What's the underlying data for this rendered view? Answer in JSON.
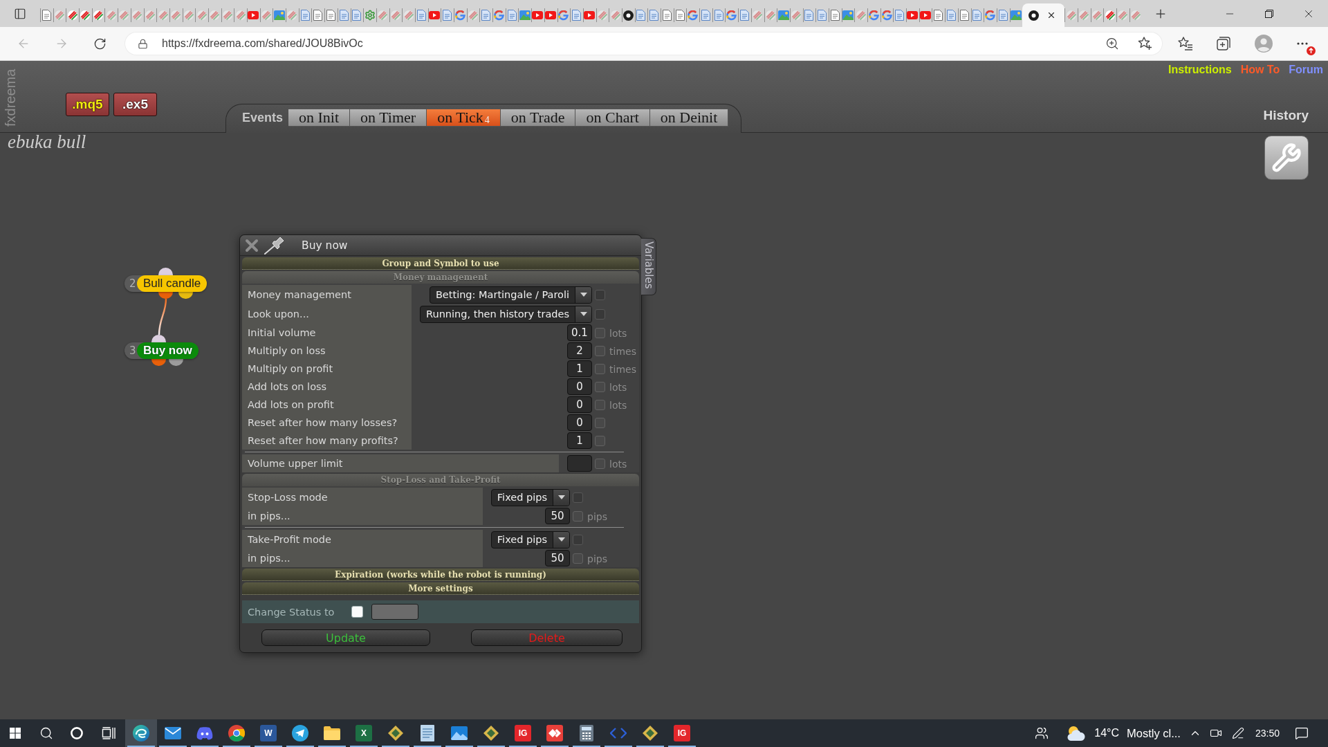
{
  "browser": {
    "tabs": [
      {
        "kind": "page",
        "sleeping": false,
        "selected": false
      },
      {
        "kind": "pen",
        "sleeping": true,
        "selected": false
      },
      {
        "kind": "pen",
        "sleeping": false,
        "selected": false
      },
      {
        "kind": "pen",
        "sleeping": false,
        "selected": false
      },
      {
        "kind": "pen",
        "sleeping": false,
        "selected": false
      },
      {
        "kind": "pen",
        "sleeping": true,
        "selected": false
      },
      {
        "kind": "pen",
        "sleeping": true,
        "selected": false
      },
      {
        "kind": "pen",
        "sleeping": true,
        "selected": false
      },
      {
        "kind": "pen",
        "sleeping": true,
        "selected": false
      },
      {
        "kind": "pen",
        "sleeping": true,
        "selected": false
      },
      {
        "kind": "pen",
        "sleeping": true,
        "selected": false
      },
      {
        "kind": "pen",
        "sleeping": true,
        "selected": false
      },
      {
        "kind": "pen",
        "sleeping": true,
        "selected": false
      },
      {
        "kind": "pen",
        "sleeping": true,
        "selected": false
      },
      {
        "kind": "pen",
        "sleeping": true,
        "selected": false
      },
      {
        "kind": "pen",
        "sleeping": true,
        "selected": false
      },
      {
        "kind": "video",
        "sleeping": false,
        "selected": false
      },
      {
        "kind": "pen",
        "sleeping": true,
        "selected": false
      },
      {
        "kind": "image",
        "sleeping": false,
        "selected": false
      },
      {
        "kind": "pen",
        "sleeping": true,
        "selected": false
      },
      {
        "kind": "doc",
        "sleeping": false,
        "selected": false
      },
      {
        "kind": "page",
        "sleeping": false,
        "selected": false
      },
      {
        "kind": "page",
        "sleeping": false,
        "selected": false
      },
      {
        "kind": "doc",
        "sleeping": false,
        "selected": false
      },
      {
        "kind": "doc",
        "sleeping": false,
        "selected": false
      },
      {
        "kind": "gear",
        "sleeping": false,
        "selected": false
      },
      {
        "kind": "pen",
        "sleeping": true,
        "selected": false
      },
      {
        "kind": "pen",
        "sleeping": true,
        "selected": false
      },
      {
        "kind": "pen",
        "sleeping": true,
        "selected": false
      },
      {
        "kind": "doc",
        "sleeping": false,
        "selected": false
      },
      {
        "kind": "video",
        "sleeping": false,
        "selected": false
      },
      {
        "kind": "doc",
        "sleeping": false,
        "selected": false
      },
      {
        "kind": "google",
        "sleeping": false,
        "selected": false
      },
      {
        "kind": "pen",
        "sleeping": true,
        "selected": false
      },
      {
        "kind": "doc",
        "sleeping": false,
        "selected": false
      },
      {
        "kind": "google",
        "sleeping": false,
        "selected": false
      },
      {
        "kind": "doc",
        "sleeping": false,
        "selected": false
      },
      {
        "kind": "image",
        "sleeping": false,
        "selected": false
      },
      {
        "kind": "video",
        "sleeping": false,
        "selected": false
      },
      {
        "kind": "video",
        "sleeping": false,
        "selected": false
      },
      {
        "kind": "google",
        "sleeping": false,
        "selected": false
      },
      {
        "kind": "doc",
        "sleeping": false,
        "selected": false
      },
      {
        "kind": "video",
        "sleeping": false,
        "selected": false
      },
      {
        "kind": "pen",
        "sleeping": true,
        "selected": false
      },
      {
        "kind": "pen",
        "sleeping": true,
        "selected": false
      },
      {
        "kind": "dot",
        "sleeping": false,
        "selected": false
      },
      {
        "kind": "doc",
        "sleeping": false,
        "selected": false
      },
      {
        "kind": "doc",
        "sleeping": false,
        "selected": false
      },
      {
        "kind": "page",
        "sleeping": false,
        "selected": false
      },
      {
        "kind": "page",
        "sleeping": false,
        "selected": false
      },
      {
        "kind": "google",
        "sleeping": false,
        "selected": false
      },
      {
        "kind": "doc",
        "sleeping": false,
        "selected": false
      },
      {
        "kind": "doc",
        "sleeping": false,
        "selected": false
      },
      {
        "kind": "google",
        "sleeping": false,
        "selected": false
      },
      {
        "kind": "doc",
        "sleeping": false,
        "selected": false
      },
      {
        "kind": "pen",
        "sleeping": true,
        "selected": false
      },
      {
        "kind": "pen",
        "sleeping": true,
        "selected": false
      },
      {
        "kind": "image",
        "sleeping": false,
        "selected": false
      },
      {
        "kind": "pen",
        "sleeping": true,
        "selected": false
      },
      {
        "kind": "doc",
        "sleeping": false,
        "selected": false
      },
      {
        "kind": "doc",
        "sleeping": false,
        "selected": false
      },
      {
        "kind": "page",
        "sleeping": false,
        "selected": false
      },
      {
        "kind": "image",
        "sleeping": false,
        "selected": false
      },
      {
        "kind": "pen",
        "sleeping": true,
        "selected": false
      },
      {
        "kind": "google",
        "sleeping": false,
        "selected": false
      },
      {
        "kind": "google",
        "sleeping": false,
        "selected": false
      },
      {
        "kind": "doc",
        "sleeping": false,
        "selected": false
      },
      {
        "kind": "video",
        "sleeping": false,
        "selected": false
      },
      {
        "kind": "video",
        "sleeping": false,
        "selected": false
      },
      {
        "kind": "page",
        "sleeping": false,
        "selected": false
      },
      {
        "kind": "doc",
        "sleeping": false,
        "selected": false
      },
      {
        "kind": "page",
        "sleeping": false,
        "selected": false
      },
      {
        "kind": "doc",
        "sleeping": false,
        "selected": false
      },
      {
        "kind": "google",
        "sleeping": false,
        "selected": false
      },
      {
        "kind": "doc",
        "sleeping": false,
        "selected": false
      },
      {
        "kind": "image",
        "sleeping": false,
        "selected": false
      },
      {
        "kind": "dot",
        "sleeping": false,
        "selected": true
      },
      {
        "kind": "pen",
        "sleeping": true,
        "selected": false
      },
      {
        "kind": "pen",
        "sleeping": true,
        "selected": false
      },
      {
        "kind": "pen",
        "sleeping": true,
        "selected": false
      },
      {
        "kind": "pen",
        "sleeping": false,
        "selected": false
      },
      {
        "kind": "pen",
        "sleeping": true,
        "selected": false
      },
      {
        "kind": "pen",
        "sleeping": true,
        "selected": false
      }
    ],
    "address": "https://fxdreema.com/shared/JOU8BivOc"
  },
  "page": {
    "brand": "fxdreema",
    "downloads": [
      {
        "label": ".mq5",
        "kind": "source"
      },
      {
        "label": ".ex5",
        "kind": "compiled"
      }
    ],
    "events_label": "Events",
    "event_tabs": [
      {
        "label": "on Init",
        "selected": false
      },
      {
        "label": "on Timer",
        "selected": false
      },
      {
        "label": "on Tick",
        "count": "4",
        "selected": true
      },
      {
        "label": "on Trade",
        "selected": false
      },
      {
        "label": "on Chart",
        "selected": false
      },
      {
        "label": "on Deinit",
        "selected": false
      }
    ],
    "links": [
      {
        "label": "Instructions",
        "color": "#ccee00"
      },
      {
        "label": "How To",
        "color": "#ff5a28"
      },
      {
        "label": "Forum",
        "color": "#8090ff"
      }
    ],
    "history": "History",
    "project_name": "ebuka bull"
  },
  "canvas": {
    "nodes": [
      {
        "number": "2",
        "label": "Bull candle",
        "kind": "condition",
        "color": "#f7c600"
      },
      {
        "number": "3",
        "label": "Buy now",
        "kind": "action",
        "color": "#0b8a0b"
      }
    ]
  },
  "dialog": {
    "title": "Buy now",
    "side_tab": "Variables",
    "sections": [
      {
        "title": "Group and Symbol to use",
        "expanded": false
      },
      {
        "title": "Money management",
        "expanded": true,
        "groups": [
          [
            {
              "kind": "select",
              "label": "Money management",
              "value": "Betting: Martingale / Paroli",
              "checked": false
            },
            {
              "kind": "select",
              "label": "Look upon...",
              "value": "Running, then history trades",
              "checked": false
            },
            {
              "kind": "number",
              "label": "Initial volume",
              "value": "0.1",
              "unit": "lots",
              "checked": false
            },
            {
              "kind": "number",
              "label": "Multiply on loss",
              "value": "2",
              "unit": "times",
              "checked": false
            },
            {
              "kind": "number",
              "label": "Multiply on profit",
              "value": "1",
              "unit": "times",
              "checked": false
            },
            {
              "kind": "number",
              "label": "Add lots on loss",
              "value": "0",
              "unit": "lots",
              "checked": false
            },
            {
              "kind": "number",
              "label": "Add lots on profit",
              "value": "0",
              "unit": "lots",
              "checked": false
            },
            {
              "kind": "number",
              "label": "Reset after how many losses?",
              "value": "0",
              "checked": false
            },
            {
              "kind": "number",
              "label": "Reset after how many profits?",
              "value": "1",
              "checked": false
            }
          ],
          [
            {
              "kind": "number",
              "label": "Volume upper limit",
              "unit": "lots",
              "checked": false
            }
          ]
        ]
      },
      {
        "title": "Stop-Loss and Take-Profit",
        "expanded": true,
        "groups": [
          [
            {
              "kind": "select",
              "label": "Stop-Loss mode",
              "value": "Fixed pips",
              "checked": false
            },
            {
              "kind": "number",
              "label": "in pips...",
              "value": "50",
              "unit": "pips",
              "checked": false
            }
          ],
          [
            {
              "kind": "select",
              "label": "Take-Profit mode",
              "value": "Fixed pips",
              "checked": false
            },
            {
              "kind": "number",
              "label": "in pips...",
              "value": "50",
              "unit": "pips",
              "checked": false
            }
          ]
        ]
      },
      {
        "title": "Expiration (works while the robot is running)",
        "expanded": false
      },
      {
        "title": "More settings",
        "expanded": false
      }
    ],
    "status": {
      "label": "Change Status to",
      "checked": false
    },
    "buttons": [
      {
        "label": "Update",
        "kind": "confirm"
      },
      {
        "label": "Delete",
        "kind": "danger"
      }
    ]
  },
  "taskbar": {
    "apps": [
      {
        "kind": "browser",
        "running": true,
        "selected": true
      },
      {
        "kind": "mail",
        "running": true,
        "selected": false
      },
      {
        "kind": "chat",
        "running": true,
        "selected": false
      },
      {
        "kind": "wheel",
        "running": true,
        "selected": false
      },
      {
        "kind": "tile",
        "label": "W",
        "color": "#2b579a",
        "running": true,
        "selected": false
      },
      {
        "kind": "send",
        "running": true,
        "selected": false
      },
      {
        "kind": "folder",
        "running": true,
        "selected": false
      },
      {
        "kind": "tile",
        "label": "X",
        "color": "#1d7044",
        "running": true,
        "selected": false
      },
      {
        "kind": "diamond",
        "color": "#d9b64a",
        "running": true,
        "selected": false
      },
      {
        "kind": "notepad",
        "running": true,
        "selected": false
      },
      {
        "kind": "photo",
        "running": true,
        "selected": false
      },
      {
        "kind": "diamond",
        "color": "#d9b64a",
        "running": true,
        "selected": false
      },
      {
        "kind": "tile",
        "label": "IG",
        "color": "#e3262b",
        "running": true,
        "selected": false
      },
      {
        "kind": "remote",
        "color": "#e8403a",
        "running": true,
        "selected": false
      },
      {
        "kind": "calculator",
        "running": true,
        "selected": false
      },
      {
        "kind": "code",
        "running": true,
        "selected": false
      },
      {
        "kind": "diamond",
        "color": "#d9b64a",
        "running": true,
        "selected": false
      },
      {
        "kind": "tile",
        "label": "IG",
        "color": "#e3262b",
        "running": true,
        "selected": false
      }
    ],
    "temperature": "14°C",
    "weather": "Mostly cl...",
    "time": "23:50"
  }
}
